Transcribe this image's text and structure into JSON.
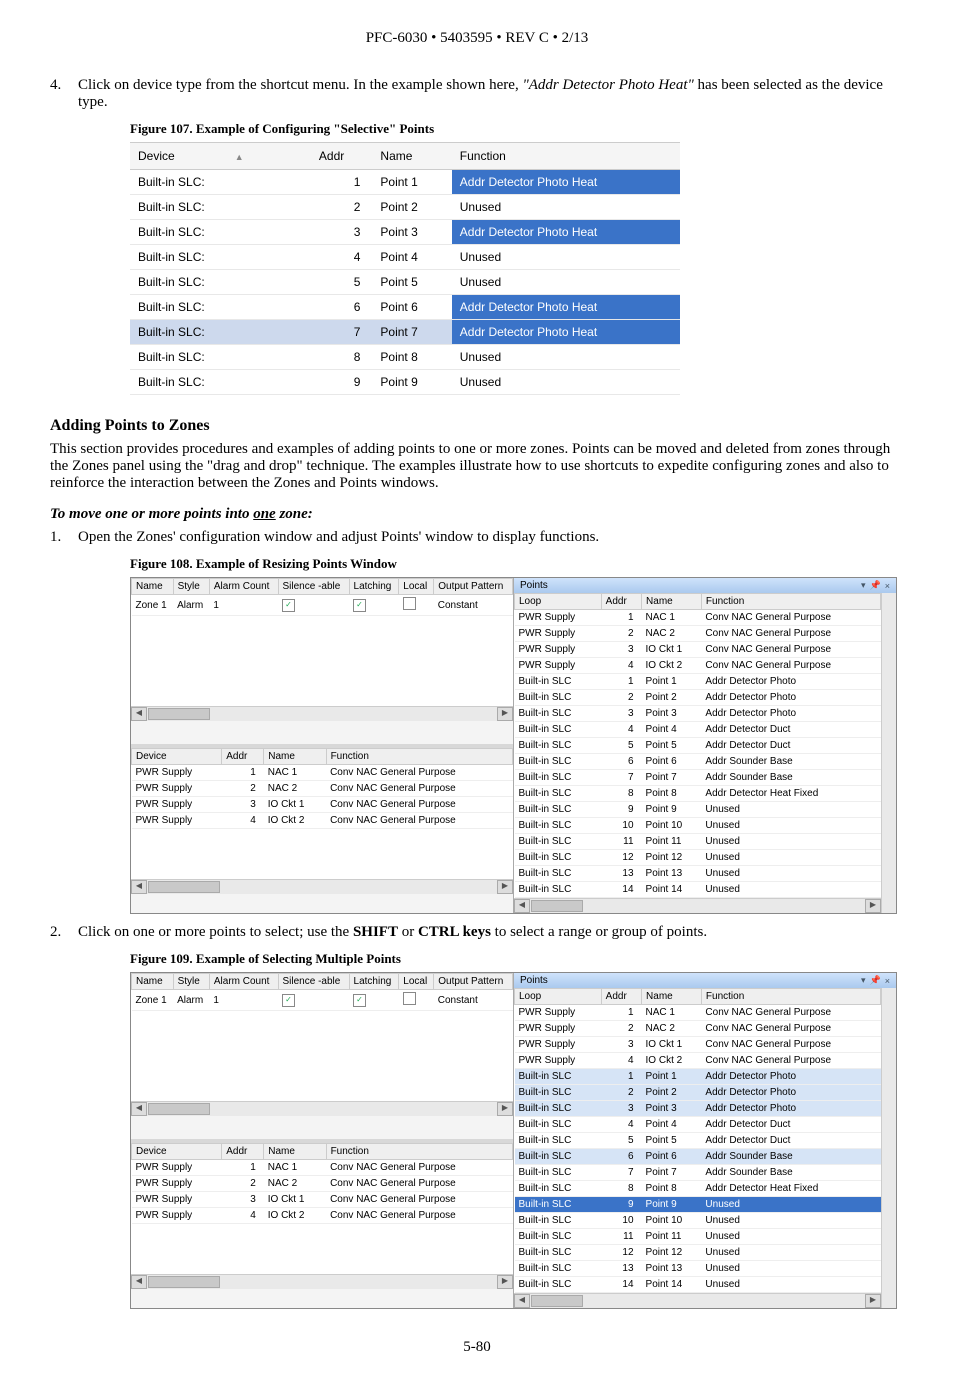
{
  "header": "PFC-6030 • 5403595 • REV C • 2/13",
  "footer": "5-80",
  "step4": {
    "num": "4.",
    "text_a": "Click on device type from the shortcut menu. In the example shown here, ",
    "text_b": "\"Addr Detector Photo Heat\"",
    "text_c": " has been selected as the device type."
  },
  "fig107": {
    "caption": "Figure 107. Example of Configuring \"Selective\" Points",
    "cols": [
      "Device",
      "Addr",
      "Name",
      "Function"
    ],
    "rows": [
      {
        "d": "Built-in SLC:",
        "a": "1",
        "n": "Point 1",
        "f": "Addr Detector Photo Heat",
        "sel": true
      },
      {
        "d": "Built-in SLC:",
        "a": "2",
        "n": "Point 2",
        "f": "Unused"
      },
      {
        "d": "Built-in SLC:",
        "a": "3",
        "n": "Point 3",
        "f": "Addr Detector Photo Heat",
        "sel": true
      },
      {
        "d": "Built-in SLC:",
        "a": "4",
        "n": "Point 4",
        "f": "Unused"
      },
      {
        "d": "Built-in SLC:",
        "a": "5",
        "n": "Point 5",
        "f": "Unused"
      },
      {
        "d": "Built-in SLC:",
        "a": "6",
        "n": "Point 6",
        "f": "Addr Detector Photo Heat",
        "sel": true
      },
      {
        "d": "Built-in SLC:",
        "a": "7",
        "n": "Point 7",
        "f": "Addr Detector Photo Heat",
        "sel": true,
        "row": true
      },
      {
        "d": "Built-in SLC:",
        "a": "8",
        "n": "Point 8",
        "f": "Unused"
      },
      {
        "d": "Built-in SLC:",
        "a": "9",
        "n": "Point 9",
        "f": "Unused"
      }
    ]
  },
  "h3": "Adding Points to Zones",
  "para1": "This section provides procedures and examples of adding points to one or more zones. Points can be moved and deleted from zones through the Zones panel using the \"drag and drop\" technique. The examples illustrate how to use shortcuts to expedite configuring zones and also to reinforce the interaction between the Zones and Points windows.",
  "sub_inst": {
    "a": "To move one or more points into ",
    "b": "one",
    "c": " zone:"
  },
  "step1": {
    "num": "1.",
    "text": "Open the Zones' configuration window and adjust Points' window to display functions."
  },
  "fig108": {
    "caption": "Figure 108. Example of Resizing Points Window",
    "zone_cols": [
      "Name",
      "Style",
      "Alarm Count",
      "Silence -able",
      "Latching",
      "Local",
      "Output Pattern"
    ],
    "zone_row": {
      "name": "Zone 1",
      "style": "Alarm",
      "alarm": "1",
      "sil": "✓",
      "latch": "✓",
      "local": "",
      "out": "Constant"
    },
    "device_cols": [
      "Device",
      "Addr",
      "Name",
      "Function"
    ],
    "device_rows": [
      {
        "d": "PWR Supply",
        "a": "1",
        "n": "NAC 1",
        "f": "Conv NAC General Purpose"
      },
      {
        "d": "PWR Supply",
        "a": "2",
        "n": "NAC 2",
        "f": "Conv NAC General Purpose"
      },
      {
        "d": "PWR Supply",
        "a": "3",
        "n": "IO Ckt 1",
        "f": "Conv NAC General Purpose"
      },
      {
        "d": "PWR Supply",
        "a": "4",
        "n": "IO Ckt 2",
        "f": "Conv NAC General Purpose"
      }
    ],
    "points_title": "Points",
    "points_cols": [
      "Loop",
      "Addr",
      "Name",
      "Function"
    ],
    "points_rows": [
      {
        "d": "PWR Supply",
        "a": "1",
        "n": "NAC 1",
        "f": "Conv NAC General Purpose"
      },
      {
        "d": "PWR Supply",
        "a": "2",
        "n": "NAC 2",
        "f": "Conv NAC General Purpose"
      },
      {
        "d": "PWR Supply",
        "a": "3",
        "n": "IO Ckt 1",
        "f": "Conv NAC General Purpose"
      },
      {
        "d": "PWR Supply",
        "a": "4",
        "n": "IO Ckt 2",
        "f": "Conv NAC General Purpose"
      },
      {
        "d": "Built-in SLC",
        "a": "1",
        "n": "Point 1",
        "f": "Addr Detector Photo"
      },
      {
        "d": "Built-in SLC",
        "a": "2",
        "n": "Point 2",
        "f": "Addr Detector Photo"
      },
      {
        "d": "Built-in SLC",
        "a": "3",
        "n": "Point 3",
        "f": "Addr Detector Photo"
      },
      {
        "d": "Built-in SLC",
        "a": "4",
        "n": "Point 4",
        "f": "Addr Detector Duct"
      },
      {
        "d": "Built-in SLC",
        "a": "5",
        "n": "Point 5",
        "f": "Addr Detector Duct"
      },
      {
        "d": "Built-in SLC",
        "a": "6",
        "n": "Point 6",
        "f": "Addr Sounder Base"
      },
      {
        "d": "Built-in SLC",
        "a": "7",
        "n": "Point 7",
        "f": "Addr Sounder Base"
      },
      {
        "d": "Built-in SLC",
        "a": "8",
        "n": "Point 8",
        "f": "Addr Detector Heat Fixed"
      },
      {
        "d": "Built-in SLC",
        "a": "9",
        "n": "Point 9",
        "f": "Unused"
      },
      {
        "d": "Built-in SLC",
        "a": "10",
        "n": "Point 10",
        "f": "Unused"
      },
      {
        "d": "Built-in SLC",
        "a": "11",
        "n": "Point 11",
        "f": "Unused"
      },
      {
        "d": "Built-in SLC",
        "a": "12",
        "n": "Point 12",
        "f": "Unused"
      },
      {
        "d": "Built-in SLC",
        "a": "13",
        "n": "Point 13",
        "f": "Unused"
      },
      {
        "d": "Built-in SLC",
        "a": "14",
        "n": "Point 14",
        "f": "Unused"
      }
    ]
  },
  "step2": {
    "num": "2.",
    "text_a": "Click on one or more points to select; use the ",
    "text_b": "SHIFT",
    "text_c": " or ",
    "text_d": "CTRL keys",
    "text_e": " to select a range or group of points."
  },
  "fig109": {
    "caption": "Figure 109. Example of Selecting Multiple Points",
    "selected_idx": [
      4,
      5,
      6,
      9,
      12
    ]
  }
}
